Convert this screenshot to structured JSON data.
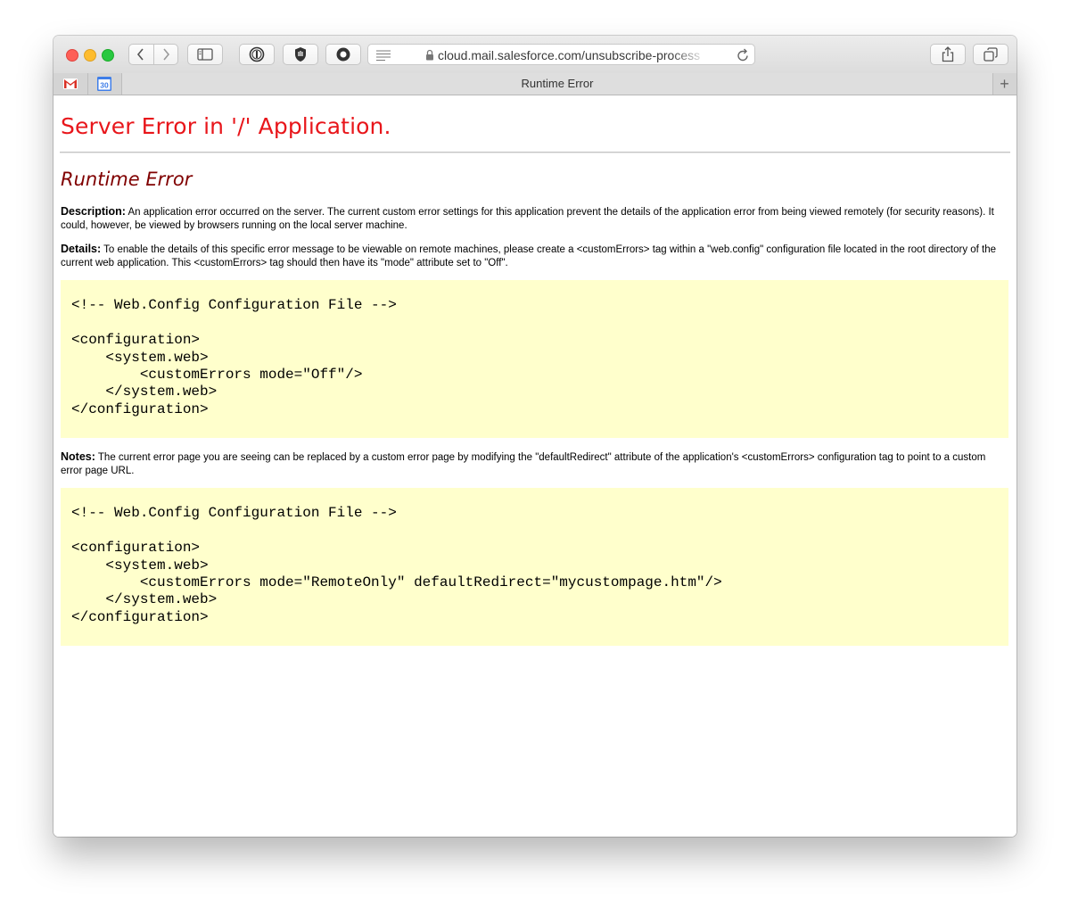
{
  "browser": {
    "url": "cloud.mail.salesforce.com/unsubscribe-process",
    "tab_title": "Runtime Error",
    "pinned_tabs": [
      {
        "name": "gmail",
        "label": "M"
      },
      {
        "name": "calendar",
        "label": "30"
      }
    ],
    "new_tab_label": "+"
  },
  "page": {
    "heading": "Server Error in '/' Application.",
    "subheading": "Runtime Error",
    "description_label": "Description:",
    "description_text": " An application error occurred on the server. The current custom error settings for this application prevent the details of the application error from being viewed remotely (for security reasons). It could, however, be viewed by browsers running on the local server machine.",
    "details_label": "Details:",
    "details_text": " To enable the details of this specific error message to be viewable on remote machines, please create a <customErrors> tag within a \"web.config\" configuration file located in the root directory of the current web application. This <customErrors> tag should then have its \"mode\" attribute set to \"Off\".",
    "code_block_1": "\n<!-- Web.Config Configuration File -->\n\n<configuration>\n    <system.web>\n        <customErrors mode=\"Off\"/>\n    </system.web>\n</configuration>",
    "notes_label": "Notes:",
    "notes_text": " The current error page you are seeing can be replaced by a custom error page by modifying the \"defaultRedirect\" attribute of the application's <customErrors> configuration tag to point to a custom error page URL.",
    "code_block_2": "\n<!-- Web.Config Configuration File -->\n\n<configuration>\n    <system.web>\n        <customErrors mode=\"RemoteOnly\" defaultRedirect=\"mycustompage.htm\"/>\n    </system.web>\n</configuration>"
  },
  "colors": {
    "heading": "#e8161b",
    "subheading": "#800000",
    "code_background": "#ffffcc"
  }
}
